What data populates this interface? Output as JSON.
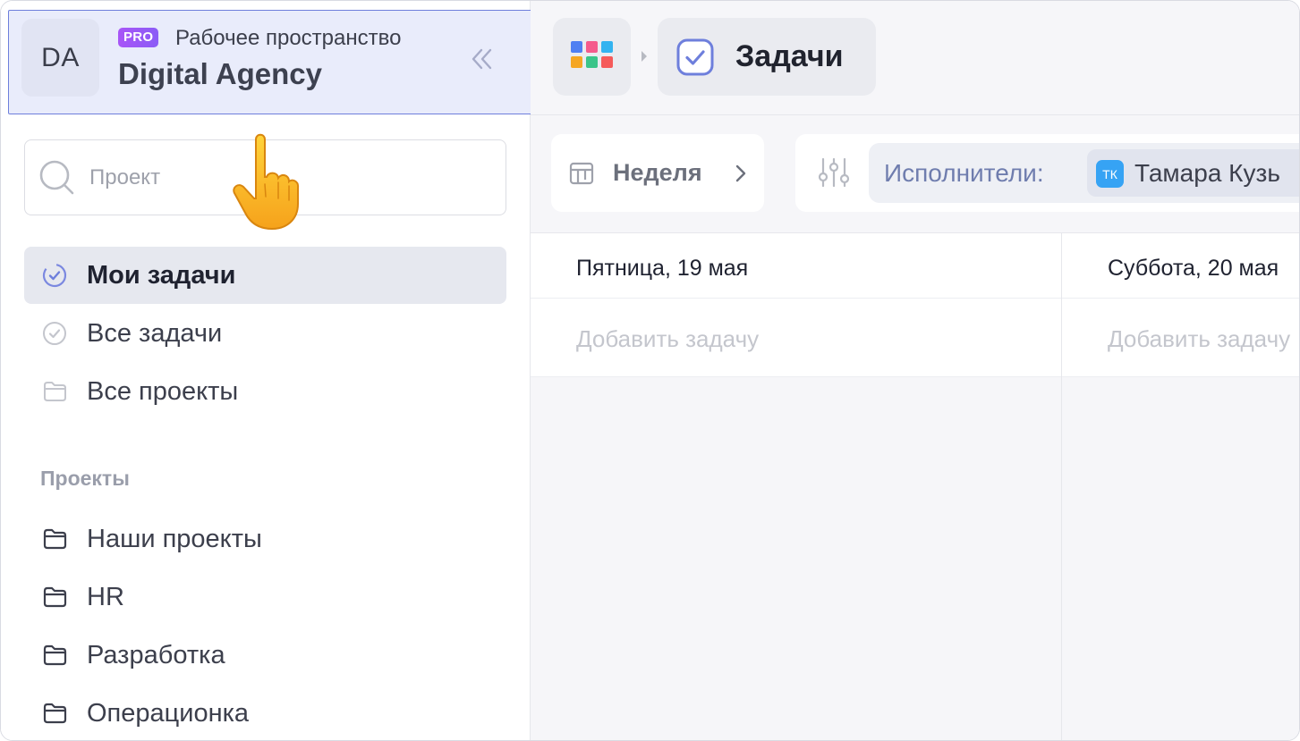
{
  "workspace": {
    "avatar_initials": "DA",
    "badge": "PRO",
    "subtitle": "Рабочее пространство",
    "name": "Digital Agency",
    "collapse_icon": "double-chevron-left-icon"
  },
  "search": {
    "placeholder": "Проект",
    "icon": "search-icon"
  },
  "nav": {
    "my_tasks": "Мои задачи",
    "all_tasks": "Все задачи",
    "all_projects": "Все проекты"
  },
  "projects": {
    "title": "Проекты",
    "items": [
      {
        "label": "Наши проекты"
      },
      {
        "label": "HR"
      },
      {
        "label": "Разработка"
      },
      {
        "label": "Операционка"
      }
    ]
  },
  "topbar": {
    "apps_icon": "apps-grid-icon",
    "page_title": "Задачи",
    "page_icon": "checkbox-icon"
  },
  "toolbar": {
    "period": "Неделя",
    "assignees_label": "Исполнители:",
    "assignee_initials": "ТК",
    "assignee_name": "Тамара Кузь"
  },
  "board": {
    "days": [
      {
        "title": "Пятница, 19 мая",
        "add_label": "Добавить задачу"
      },
      {
        "title": "Суббота, 20 мая",
        "add_label": "Добавить задачу"
      }
    ]
  },
  "colors": {
    "accent": "#6e7fdc",
    "pro_badge": "#a855f7",
    "assignee_avatar": "#36a3f4",
    "apps_grid": [
      "#4f7ff2",
      "#f55a8c",
      "#33b3f0",
      "#f5a623",
      "#3ac489",
      "#f55a5a"
    ]
  }
}
